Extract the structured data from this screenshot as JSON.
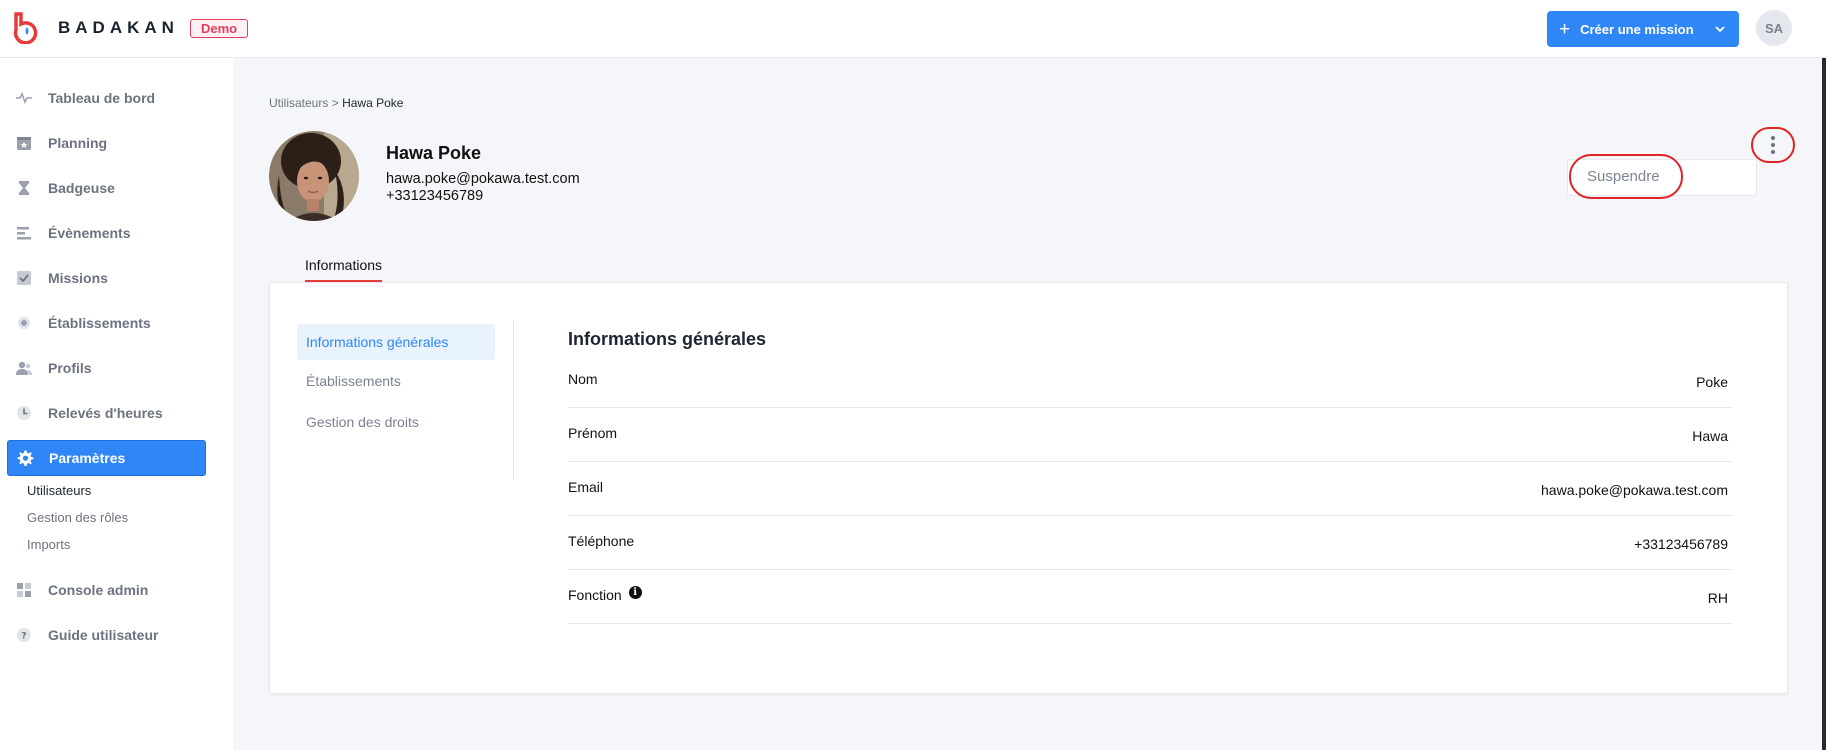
{
  "header": {
    "brand": "BADAKAN",
    "badge": "Demo",
    "create_button": "Créer une mission",
    "avatar_initials": "SA",
    "accent": "#2f86f6"
  },
  "sidebar": {
    "items": [
      {
        "label": "Tableau de bord",
        "icon": "pulse-icon"
      },
      {
        "label": "Planning",
        "icon": "calendar-star-icon"
      },
      {
        "label": "Badgeuse",
        "icon": "hourglass-icon"
      },
      {
        "label": "Évènements",
        "icon": "timeline-icon"
      },
      {
        "label": "Missions",
        "icon": "checkbox-icon"
      },
      {
        "label": "Établissements",
        "icon": "location-icon"
      },
      {
        "label": "Profils",
        "icon": "users-icon"
      },
      {
        "label": "Relevés d'heures",
        "icon": "clock-icon"
      },
      {
        "label": "Paramètres",
        "icon": "gear-icon"
      },
      {
        "label": "Console admin",
        "icon": "grid-icon"
      },
      {
        "label": "Guide utilisateur",
        "icon": "help-icon"
      }
    ],
    "sub_items": [
      "Utilisateurs",
      "Gestion des rôles",
      "Imports"
    ]
  },
  "breadcrumb": {
    "parent": "Utilisateurs",
    "separator": ">",
    "current": "Hawa Poke"
  },
  "profile": {
    "name": "Hawa Poke",
    "email": "hawa.poke@pokawa.test.com",
    "phone": "+33123456789"
  },
  "actions": {
    "suspend": "Suspendre"
  },
  "tabs": {
    "informations": "Informations"
  },
  "card": {
    "side_tabs": [
      "Informations générales",
      "Établissements",
      "Gestion des droits"
    ],
    "section_title": "Informations générales",
    "rows": [
      {
        "label": "Nom",
        "value": "Poke"
      },
      {
        "label": "Prénom",
        "value": "Hawa"
      },
      {
        "label": "Email",
        "value": "hawa.poke@pokawa.test.com"
      },
      {
        "label": "Téléphone",
        "value": "+33123456789"
      },
      {
        "label": "Fonction",
        "value": "RH"
      }
    ]
  }
}
